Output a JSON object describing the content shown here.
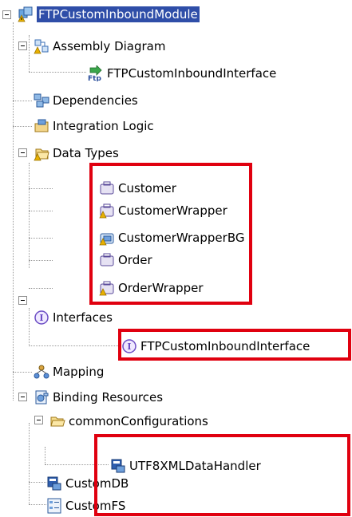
{
  "tree": {
    "module": {
      "label": "FTPCustomInboundModule",
      "icon": "module-icon"
    },
    "assembly_diagram": {
      "label": "Assembly Diagram",
      "icon": "assembly-diagram-icon"
    },
    "assembly_interface": {
      "label": "FTPCustomInboundInterface",
      "icon": "ftp-export-icon",
      "badge": "Ftp"
    },
    "dependencies": {
      "label": "Dependencies",
      "icon": "dependencies-icon"
    },
    "integration_logic": {
      "label": "Integration Logic",
      "icon": "integration-logic-icon"
    },
    "data_types": {
      "label": "Data Types",
      "icon": "folder-icon",
      "items": [
        {
          "label": "Customer",
          "icon": "business-object-icon"
        },
        {
          "label": "CustomerWrapper",
          "icon": "business-object-icon"
        },
        {
          "label": "CustomerWrapperBG",
          "icon": "business-graph-icon"
        },
        {
          "label": "Order",
          "icon": "business-object-icon"
        },
        {
          "label": "OrderWrapper",
          "icon": "business-object-icon"
        }
      ]
    },
    "interfaces": {
      "label": "Interfaces",
      "icon": "interface-icon",
      "badge": "I"
    },
    "interface_item": {
      "label": "FTPCustomInboundInterface",
      "icon": "interface-icon",
      "badge": "I"
    },
    "mapping": {
      "label": "Mapping",
      "icon": "mapping-icon"
    },
    "binding_resources": {
      "label": "Binding Resources",
      "icon": "binding-resources-icon"
    },
    "common_configurations": {
      "label": "commonConfigurations",
      "icon": "folder-open-icon"
    },
    "utf8": {
      "label": "UTF8XMLDataHandler",
      "icon": "data-handler-icon"
    },
    "customdb": {
      "label": "CustomDB",
      "icon": "data-handler-icon"
    },
    "customfs": {
      "label": "CustomFS",
      "icon": "function-selector-icon"
    }
  },
  "colors": {
    "highlight": "#e0000f",
    "selection": "#2f4ea8",
    "warning": "#e8b000",
    "interface_purple": "#6b4cc4"
  }
}
